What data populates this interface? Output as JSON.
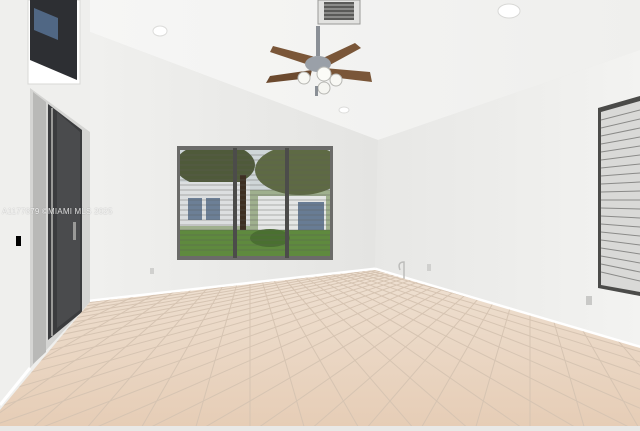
{
  "photo": {
    "watermark_text": "A1177879 ©MIAMI MLS 2025"
  },
  "colors": {
    "ceiling": "#f4f4f3",
    "wall_left": "#eeeeec",
    "wall_back": "#ebebe9",
    "wall_right": "#f1f1ef",
    "floor_tile": "#ecd9c6",
    "grout": "#dccab8",
    "window_frame": "#5a5a5a",
    "fan_blade": "#7a5638"
  }
}
